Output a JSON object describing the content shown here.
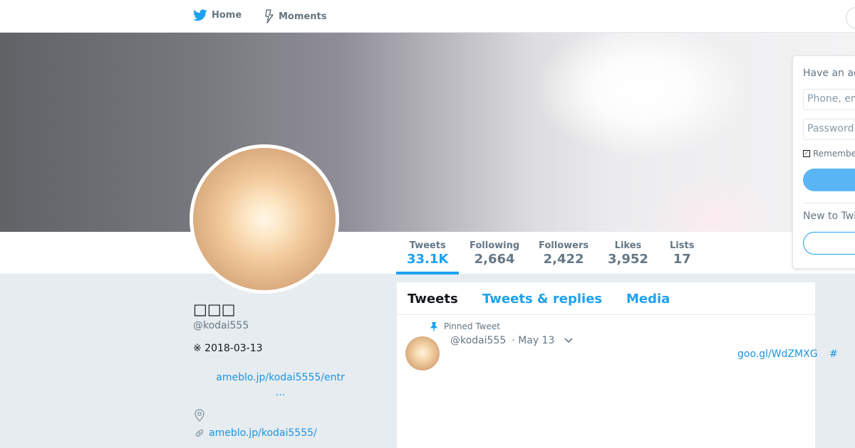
{
  "nav": {
    "home_label": "Home",
    "moments_label": "Moments"
  },
  "profile": {
    "name": "□□□",
    "handle": "@kodai555",
    "bio": "※ 2018-03-13",
    "bio_link_line1": "ameblo.jp/kodai5555/entr",
    "bio_link_line2": "…",
    "url": "ameblo.jp/kodai5555/"
  },
  "stats": [
    {
      "label": "Tweets",
      "value": "33.1K"
    },
    {
      "label": "Following",
      "value": "2,664"
    },
    {
      "label": "Followers",
      "value": "2,422"
    },
    {
      "label": "Likes",
      "value": "3,952"
    },
    {
      "label": "Lists",
      "value": "17"
    }
  ],
  "timeline": {
    "tabs": [
      "Tweets",
      "Tweets & replies",
      "Media"
    ],
    "pinned_label": "Pinned Tweet",
    "tweet": {
      "handle": "@kodai555",
      "date": "· May 13",
      "link": "goo.gl/WdZMXG",
      "hashtag": "#"
    }
  },
  "login": {
    "title": "Have an ac",
    "username_placeholder": "Phone, em",
    "password_placeholder": "Password",
    "remember_label": "Remembe",
    "new_label": "New to Twi"
  },
  "colors": {
    "accent": "#1da1f2",
    "link": "#1b95e0",
    "muted": "#657786",
    "background": "#e6ecf0"
  }
}
